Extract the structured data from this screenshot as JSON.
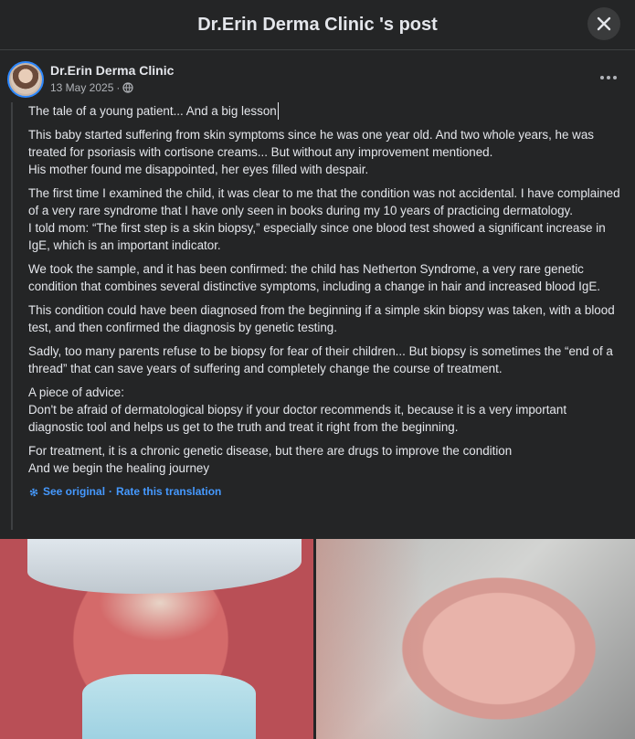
{
  "header": {
    "title": "Dr.Erin Derma Clinic 's post",
    "close_icon": "close-icon"
  },
  "post": {
    "author": "Dr.Erin Derma Clinic",
    "date": "13 May 2025",
    "dot": "·",
    "privacy_icon": "globe-icon",
    "more_icon": "more-dots-icon",
    "paragraphs": [
      "The tale of a young patient... And a big lesson",
      "This baby started suffering from skin symptoms since he was one year old. And two whole years, he was treated for psoriasis with cortisone creams... But without any improvement mentioned.\nHis mother found me disappointed, her eyes filled with despair.",
      "The first time I examined the child, it was clear to me that the condition was not accidental. I have complained of a very rare syndrome that I have only seen in books during my 10 years of practicing dermatology.\nI told mom: “The first step is a skin biopsy,” especially since one blood test showed a significant increase in IgE, which is an important indicator.",
      "We took the sample, and it has been confirmed: the child has Netherton Syndrome, a very rare genetic condition that combines several distinctive symptoms, including a change in hair and increased blood IgE.",
      "This condition could have been diagnosed from the beginning if a simple skin biopsy was taken, with a blood test, and then confirmed the diagnosis by genetic testing.",
      "Sadly, too many parents refuse to be biopsy for fear of their children... But biopsy is sometimes the “end of a thread” that can save years of suffering and completely change the course of treatment.",
      "A piece of advice:\nDon't be afraid of dermatological biopsy if your doctor recommends it, because it is a very important diagnostic tool and helps us get to the truth and treat it right from the beginning.",
      "For treatment, it is a chronic genetic disease, but there are drugs to improve the condition\nAnd we begin the healing journey"
    ],
    "translation": {
      "see_original": "See original",
      "separator": "·",
      "rate": "Rate this translation"
    }
  },
  "colors": {
    "background": "#242526",
    "text": "#e4e6eb",
    "secondary_text": "#b0b3b8",
    "link": "#4599ff",
    "avatar_ring": "#2d88ff"
  }
}
